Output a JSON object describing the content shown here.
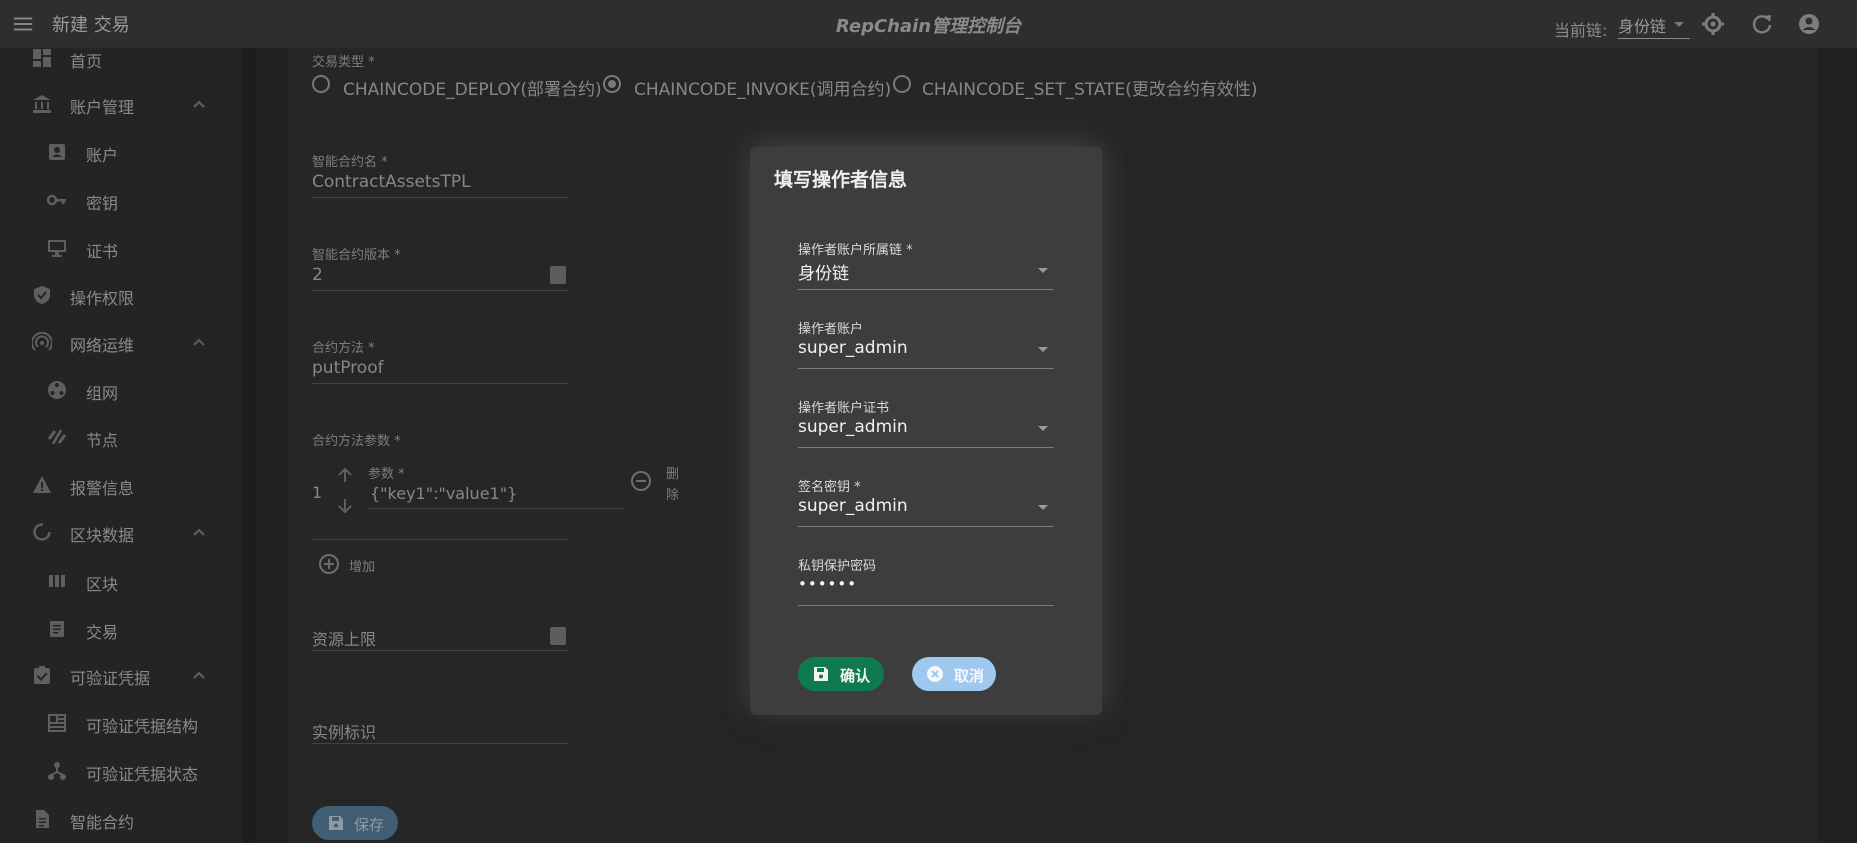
{
  "topbar": {
    "title": "新建 交易",
    "app_name": "RepChain管理控制台",
    "chain_label": "当前链:",
    "chain_value": "身份链"
  },
  "sidebar": {
    "items": [
      {
        "label": "首页",
        "icon": "dashboard-icon"
      },
      {
        "label": "账户管理",
        "icon": "bank-icon",
        "expanded": true
      },
      {
        "label": "账户",
        "icon": "contact-card-icon"
      },
      {
        "label": "密钥",
        "icon": "key-icon"
      },
      {
        "label": "证书",
        "icon": "monitor-icon"
      },
      {
        "label": "操作权限",
        "icon": "shield-icon"
      },
      {
        "label": "网络运维",
        "icon": "broadcast-icon",
        "expanded": true
      },
      {
        "label": "组网",
        "icon": "network-icon"
      },
      {
        "label": "节点",
        "icon": "node-icon"
      },
      {
        "label": "报警信息",
        "icon": "warning-icon"
      },
      {
        "label": "区块数据",
        "icon": "circle-progress-icon",
        "expanded": true
      },
      {
        "label": "区块",
        "icon": "blocks-icon"
      },
      {
        "label": "交易",
        "icon": "document-icon"
      },
      {
        "label": "可验证凭据",
        "icon": "clipboard-check-icon",
        "expanded": true
      },
      {
        "label": "可验证凭据结构",
        "icon": "dashboard-icon"
      },
      {
        "label": "可验证凭据状态",
        "icon": "hierarchy-icon"
      },
      {
        "label": "智能合约",
        "icon": "file-icon"
      }
    ]
  },
  "form": {
    "tx_type_label": "交易类型 *",
    "tx_types": [
      {
        "label": "CHAINCODE_DEPLOY(部署合约)",
        "selected": false
      },
      {
        "label": "CHAINCODE_INVOKE(调用合约)",
        "selected": true
      },
      {
        "label": "CHAINCODE_SET_STATE(更改合约有效性)",
        "selected": false
      }
    ],
    "contract_name_label": "智能合约名 *",
    "contract_name": "ContractAssetsTPL",
    "contract_version_label": "智能合约版本 *",
    "contract_version": "2",
    "method_label": "合约方法 *",
    "method": "putProof",
    "params_label": "合约方法参数 *",
    "param_index": "1",
    "param_field_label": "参数 *",
    "param_value": "{\"key1\":\"value1\"}",
    "delete_label_1": "删",
    "delete_label_2": "除",
    "add_label": "增加",
    "resource_limit_label": "资源上限",
    "instance_id_label": "实例标识",
    "save_label": "保存"
  },
  "dialog": {
    "title": "填写操作者信息",
    "fields": [
      {
        "label": "操作者账户所属链 *",
        "value": "身份链"
      },
      {
        "label": "操作者账户",
        "value": "super_admin"
      },
      {
        "label": "操作者账户证书",
        "value": "super_admin"
      },
      {
        "label": "签名密钥 *",
        "value": "super_admin"
      },
      {
        "label": "私钥保护密码",
        "value": "••••••"
      }
    ],
    "confirm_label": "确认",
    "cancel_label": "取消"
  },
  "colors": {
    "confirm": "#0f7a4f",
    "cancel": "#9ec8ee",
    "save": "#4a6c86"
  }
}
